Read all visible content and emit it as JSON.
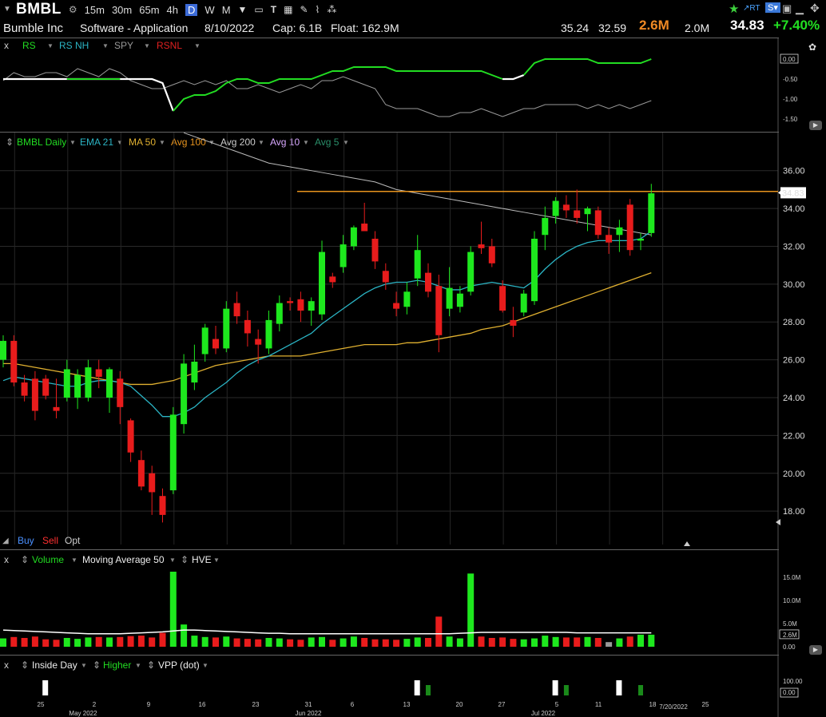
{
  "toolbar": {
    "symbol": "BMBL",
    "timeframes": [
      "15m",
      "30m",
      "65m",
      "4h",
      "D",
      "W",
      "M"
    ],
    "selected_timeframe": "D",
    "right_labels": {
      "rt": "RT",
      "s": "S"
    }
  },
  "info": {
    "name": "Bumble Inc",
    "sector": "Software - Application",
    "date": "8/10/2022",
    "cap": "Cap: 6.1B",
    "float": "Float: 162.9M",
    "high": "35.24",
    "low": "32.59",
    "volume": "2.6M",
    "avg_volume": "2.0M",
    "price": "34.83",
    "change": "+7.40%"
  },
  "rs_panel": {
    "legend": [
      "RS",
      "RS NH",
      "SPY",
      "RSNL"
    ],
    "close": "x",
    "axis": [
      "0.00",
      "-0.50",
      "-1.00",
      "-1.50"
    ]
  },
  "price_panel": {
    "legend": [
      "BMBL Daily",
      "EMA 21",
      "MA 50",
      "Avg 100",
      "Avg 200",
      "Avg 10",
      "Avg 5"
    ],
    "axis": [
      "36.00",
      "34.00",
      "32.00",
      "30.00",
      "28.00",
      "26.00",
      "24.00",
      "22.00",
      "20.00",
      "18.00"
    ],
    "last_price_tag": "34.83",
    "trade_buttons": [
      "Buy",
      "Sell",
      "Opt"
    ]
  },
  "volume_panel": {
    "legend": [
      "Volume",
      "Moving Average 50",
      "HVE"
    ],
    "close": "x",
    "axis": [
      "15.0M",
      "10.0M",
      "5.0M",
      "2.6M",
      "0.00"
    ]
  },
  "pattern_panel": {
    "legend": [
      "Inside Day",
      "Higher",
      "VPP (dot)"
    ],
    "close": "x",
    "axis": [
      "100.00",
      "0.00"
    ]
  },
  "x_axis": {
    "ticks": [
      "25",
      "May 2022",
      "2",
      "9",
      "16",
      "23",
      "Jun 2022",
      "31",
      "6",
      "13",
      "20",
      "27",
      "Jul 2022",
      "5",
      "11",
      "18",
      "25"
    ],
    "current_date_label": "7/20/2022"
  },
  "colors": {
    "up": "#1ee81e",
    "down": "#e81c1c",
    "ema21": "#2bb4c4",
    "ma50": "#e0b030",
    "avg200": "#bbbbbb",
    "resistance": "#e8941e",
    "rs": "#22dd22"
  },
  "chart_data": {
    "type": "candlestick",
    "ylim": [
      17.5,
      37
    ],
    "resistance_level": 34.9,
    "candles": [
      {
        "o": 26.0,
        "h": 27.3,
        "l": 25.6,
        "c": 27.0
      },
      {
        "o": 27.0,
        "h": 27.3,
        "l": 24.6,
        "c": 24.8
      },
      {
        "o": 24.8,
        "h": 25.2,
        "l": 23.8,
        "c": 24.1
      },
      {
        "o": 25.0,
        "h": 25.4,
        "l": 22.8,
        "c": 23.3
      },
      {
        "o": 25.0,
        "h": 25.2,
        "l": 23.9,
        "c": 24.1
      },
      {
        "o": 23.5,
        "h": 25.0,
        "l": 22.9,
        "c": 23.3
      },
      {
        "o": 24.0,
        "h": 26.0,
        "l": 23.8,
        "c": 25.5
      },
      {
        "o": 24.0,
        "h": 25.5,
        "l": 23.4,
        "c": 25.2
      },
      {
        "o": 24.0,
        "h": 26.0,
        "l": 23.8,
        "c": 25.6
      },
      {
        "o": 25.5,
        "h": 26.0,
        "l": 24.5,
        "c": 25.1
      },
      {
        "o": 24.0,
        "h": 25.6,
        "l": 23.2,
        "c": 25.5
      },
      {
        "o": 25.0,
        "h": 25.4,
        "l": 22.6,
        "c": 23.5
      },
      {
        "o": 22.8,
        "h": 22.9,
        "l": 20.6,
        "c": 21.1
      },
      {
        "o": 20.7,
        "h": 21.2,
        "l": 19.1,
        "c": 19.3
      },
      {
        "o": 20.0,
        "h": 20.4,
        "l": 17.8,
        "c": 19.0
      },
      {
        "o": 18.8,
        "h": 19.2,
        "l": 17.4,
        "c": 17.8
      },
      {
        "o": 19.1,
        "h": 23.5,
        "l": 18.9,
        "c": 23.1
      },
      {
        "o": 22.6,
        "h": 26.3,
        "l": 22.1,
        "c": 25.8
      },
      {
        "o": 24.8,
        "h": 26.8,
        "l": 24.4,
        "c": 25.9
      },
      {
        "o": 26.3,
        "h": 27.9,
        "l": 25.9,
        "c": 27.7
      },
      {
        "o": 27.1,
        "h": 27.8,
        "l": 26.3,
        "c": 26.6
      },
      {
        "o": 26.6,
        "h": 29.1,
        "l": 26.4,
        "c": 28.7
      },
      {
        "o": 29.0,
        "h": 29.6,
        "l": 27.9,
        "c": 28.3
      },
      {
        "o": 28.1,
        "h": 28.6,
        "l": 26.7,
        "c": 27.4
      },
      {
        "o": 27.1,
        "h": 27.6,
        "l": 25.8,
        "c": 26.8
      },
      {
        "o": 26.6,
        "h": 28.6,
        "l": 26.3,
        "c": 28.1
      },
      {
        "o": 27.9,
        "h": 29.4,
        "l": 27.5,
        "c": 29.0
      },
      {
        "o": 29.1,
        "h": 29.3,
        "l": 28.6,
        "c": 29.0
      },
      {
        "o": 29.2,
        "h": 29.6,
        "l": 28.0,
        "c": 28.6
      },
      {
        "o": 28.6,
        "h": 29.3,
        "l": 27.8,
        "c": 29.1
      },
      {
        "o": 28.4,
        "h": 32.3,
        "l": 28.1,
        "c": 31.7
      },
      {
        "o": 30.4,
        "h": 30.6,
        "l": 29.8,
        "c": 30.1
      },
      {
        "o": 30.9,
        "h": 32.6,
        "l": 30.6,
        "c": 32.1
      },
      {
        "o": 32.0,
        "h": 33.1,
        "l": 31.8,
        "c": 33.0
      },
      {
        "o": 33.2,
        "h": 34.3,
        "l": 32.8,
        "c": 32.8
      },
      {
        "o": 32.4,
        "h": 32.8,
        "l": 30.8,
        "c": 31.2
      },
      {
        "o": 30.7,
        "h": 31.1,
        "l": 29.7,
        "c": 30.1
      },
      {
        "o": 29.0,
        "h": 29.6,
        "l": 28.3,
        "c": 28.7
      },
      {
        "o": 28.8,
        "h": 30.1,
        "l": 28.4,
        "c": 29.6
      },
      {
        "o": 30.3,
        "h": 32.6,
        "l": 29.9,
        "c": 31.8
      },
      {
        "o": 30.6,
        "h": 31.1,
        "l": 29.3,
        "c": 29.6
      },
      {
        "o": 29.9,
        "h": 30.5,
        "l": 26.4,
        "c": 27.3
      },
      {
        "o": 28.7,
        "h": 30.9,
        "l": 28.3,
        "c": 29.8
      },
      {
        "o": 28.8,
        "h": 29.9,
        "l": 28.5,
        "c": 29.5
      },
      {
        "o": 29.6,
        "h": 32.0,
        "l": 29.4,
        "c": 31.7
      },
      {
        "o": 32.1,
        "h": 33.3,
        "l": 31.6,
        "c": 31.9
      },
      {
        "o": 32.0,
        "h": 32.4,
        "l": 30.9,
        "c": 31.1
      },
      {
        "o": 29.9,
        "h": 30.2,
        "l": 28.5,
        "c": 28.6
      },
      {
        "o": 28.1,
        "h": 28.8,
        "l": 27.2,
        "c": 27.8
      },
      {
        "o": 28.5,
        "h": 29.7,
        "l": 28.3,
        "c": 29.5
      },
      {
        "o": 29.1,
        "h": 32.8,
        "l": 28.9,
        "c": 32.4
      },
      {
        "o": 32.6,
        "h": 34.1,
        "l": 31.8,
        "c": 33.5
      },
      {
        "o": 33.6,
        "h": 34.6,
        "l": 33.2,
        "c": 34.4
      },
      {
        "o": 34.2,
        "h": 34.7,
        "l": 33.5,
        "c": 33.9
      },
      {
        "o": 33.9,
        "h": 35.0,
        "l": 33.2,
        "c": 33.5
      },
      {
        "o": 33.7,
        "h": 34.1,
        "l": 32.8,
        "c": 34.0
      },
      {
        "o": 33.9,
        "h": 34.1,
        "l": 32.4,
        "c": 32.6
      },
      {
        "o": 32.6,
        "h": 33.0,
        "l": 31.6,
        "c": 32.2
      },
      {
        "o": 32.6,
        "h": 33.4,
        "l": 31.7,
        "c": 33.0
      },
      {
        "o": 34.2,
        "h": 34.5,
        "l": 31.5,
        "c": 31.8
      },
      {
        "o": 32.3,
        "h": 32.7,
        "l": 31.8,
        "c": 32.4
      },
      {
        "o": 32.7,
        "h": 35.3,
        "l": 32.5,
        "c": 34.8
      }
    ],
    "ema21": [
      24.9,
      25.1,
      25.0,
      24.9,
      24.8,
      24.7,
      24.6,
      24.6,
      24.8,
      24.9,
      24.9,
      24.8,
      24.6,
      24.1,
      23.6,
      23.0,
      23.0,
      23.2,
      23.5,
      24.0,
      24.4,
      24.8,
      25.3,
      25.7,
      26.0,
      26.2,
      26.5,
      26.8,
      27.1,
      27.4,
      27.9,
      28.3,
      28.7,
      29.1,
      29.5,
      29.8,
      30.0,
      30.1,
      30.1,
      30.2,
      30.1,
      29.9,
      29.7,
      29.7,
      29.9,
      30.0,
      30.1,
      30.0,
      29.9,
      29.8,
      30.2,
      30.8,
      31.3,
      31.7,
      32.0,
      32.2,
      32.3,
      32.3,
      32.3,
      32.3,
      32.4,
      32.8
    ],
    "ma50": [
      25.8,
      25.8,
      25.7,
      25.6,
      25.5,
      25.4,
      25.3,
      25.2,
      25.1,
      25.0,
      24.9,
      24.8,
      24.7,
      24.7,
      24.7,
      24.8,
      24.9,
      25.1,
      25.3,
      25.5,
      25.7,
      25.8,
      25.9,
      26.0,
      26.1,
      26.2,
      26.2,
      26.2,
      26.2,
      26.3,
      26.4,
      26.5,
      26.6,
      26.7,
      26.8,
      26.8,
      26.8,
      26.8,
      26.9,
      26.9,
      27.0,
      27.1,
      27.2,
      27.3,
      27.4,
      27.6,
      27.7,
      27.8,
      28.0,
      28.2,
      28.4,
      28.6,
      28.8,
      29.0,
      29.2,
      29.4,
      29.6,
      29.8,
      30.0,
      30.2,
      30.4,
      30.6
    ],
    "avg200_x": [
      17,
      18,
      19,
      20,
      21,
      22,
      23,
      24,
      25,
      26,
      27,
      28,
      29,
      30,
      31,
      32,
      33,
      34,
      35,
      36,
      37,
      38,
      39,
      40,
      41,
      42,
      43,
      44,
      45,
      46,
      47,
      48,
      49,
      50,
      51,
      52,
      53,
      54,
      55,
      56,
      57,
      58,
      59,
      60,
      61
    ],
    "avg200": [
      38.0,
      37.8,
      37.6,
      37.4,
      37.2,
      37.0,
      36.8,
      36.6,
      36.4,
      36.3,
      36.2,
      36.1,
      36.0,
      35.9,
      35.8,
      35.7,
      35.6,
      35.5,
      35.4,
      35.2,
      35.0,
      34.9,
      34.8,
      34.7,
      34.6,
      34.5,
      34.4,
      34.3,
      34.2,
      34.1,
      34.0,
      33.9,
      33.8,
      33.7,
      33.6,
      33.5,
      33.4,
      33.3,
      33.2,
      33.1,
      33.0,
      32.9,
      32.8,
      32.7,
      32.6
    ],
    "volume_m": [
      1.8,
      2.1,
      1.9,
      2.2,
      1.6,
      1.5,
      1.9,
      1.7,
      2.0,
      2.1,
      2.0,
      2.1,
      2.3,
      2.4,
      2.0,
      3.0,
      16.2,
      4.8,
      2.4,
      2.1,
      2.0,
      2.2,
      1.8,
      1.7,
      1.6,
      1.9,
      1.8,
      1.6,
      1.5,
      2.0,
      2.1,
      1.5,
      1.8,
      2.2,
      1.9,
      1.6,
      1.6,
      1.5,
      1.7,
      2.0,
      1.9,
      6.5,
      2.2,
      1.8,
      15.8,
      2.2,
      1.9,
      2.0,
      1.7,
      1.6,
      1.8,
      2.4,
      2.1,
      2.0,
      2.0,
      2.1,
      1.9,
      1.0,
      1.8,
      2.2,
      2.6,
      2.6
    ],
    "volume_ma50": [
      3.6,
      3.5,
      3.4,
      3.3,
      3.2,
      3.1,
      3.0,
      2.9,
      2.8,
      2.8,
      2.8,
      2.8,
      2.9,
      3.0,
      3.1,
      3.2,
      3.4,
      3.6,
      3.6,
      3.5,
      3.4,
      3.3,
      3.2,
      3.1,
      3.0,
      2.9,
      2.9,
      2.8,
      2.8,
      2.8,
      2.8,
      2.8,
      2.8,
      2.8,
      2.8,
      2.8,
      2.8,
      2.8,
      2.8,
      2.8,
      2.8,
      2.8,
      2.8,
      2.9,
      3.0,
      3.1,
      3.1,
      3.1,
      3.1,
      3.1,
      3.1,
      3.1,
      3.1,
      3.1,
      3.0,
      3.0,
      3.0,
      3.0,
      3.0,
      3.0,
      3.0,
      3.0
    ],
    "rs_line": [
      -0.5,
      -0.5,
      -0.5,
      -0.5,
      -0.5,
      -0.5,
      -0.5,
      -0.5,
      -0.5,
      -0.5,
      -0.5,
      -0.5,
      -0.5,
      -0.5,
      -0.5,
      -0.6,
      -1.3,
      -1.0,
      -0.9,
      -0.9,
      -0.8,
      -0.6,
      -0.5,
      -0.5,
      -0.6,
      -0.6,
      -0.5,
      -0.5,
      -0.5,
      -0.5,
      -0.4,
      -0.3,
      -0.3,
      -0.2,
      -0.2,
      -0.2,
      -0.2,
      -0.3,
      -0.3,
      -0.3,
      -0.3,
      -0.3,
      -0.3,
      -0.3,
      -0.3,
      -0.3,
      -0.4,
      -0.5,
      -0.5,
      -0.4,
      -0.1,
      0.0,
      0.0,
      0.0,
      0.0,
      0.0,
      -0.1,
      -0.1,
      -0.1,
      -0.1,
      -0.1,
      0.0
    ],
    "spy_line": [
      -0.5,
      -0.3,
      -0.4,
      -0.4,
      -0.3,
      -0.3,
      -0.4,
      -0.2,
      -0.3,
      -0.4,
      -0.2,
      -0.3,
      -0.5,
      -0.6,
      -0.7,
      -0.7,
      -0.6,
      -0.5,
      -0.6,
      -0.5,
      -0.6,
      -0.5,
      -0.7,
      -0.7,
      -0.6,
      -0.7,
      -0.8,
      -0.7,
      -0.6,
      -0.7,
      -0.5,
      -0.5,
      -0.4,
      -0.5,
      -0.6,
      -0.7,
      -1.1,
      -1.2,
      -1.2,
      -1.2,
      -1.3,
      -1.4,
      -1.4,
      -1.3,
      -1.3,
      -1.2,
      -1.3,
      -1.4,
      -1.3,
      -1.2,
      -1.2,
      -1.1,
      -1.1,
      -1.1,
      -1.1,
      -1.2,
      -1.1,
      -1.2,
      -1.1,
      -1.2,
      -1.1,
      -1.0
    ],
    "inside_day": [
      0,
      0,
      0,
      0,
      1,
      0,
      0,
      0,
      0,
      0,
      0,
      0,
      0,
      0,
      0,
      0,
      0,
      0,
      0,
      0,
      0,
      0,
      0,
      0,
      0,
      0,
      0,
      0,
      0,
      0,
      0,
      0,
      0,
      0,
      0,
      0,
      0,
      0,
      0,
      1,
      0,
      0,
      0,
      0,
      0,
      0,
      0,
      0,
      0,
      0,
      0,
      0,
      1,
      0,
      0,
      0,
      0,
      0,
      1,
      0,
      0,
      0
    ],
    "higher": [
      0,
      0,
      0,
      0,
      0,
      0,
      0,
      0,
      0,
      0,
      0,
      0,
      0,
      0,
      0,
      0,
      0,
      0,
      0,
      0,
      0,
      0,
      0,
      0,
      0,
      0,
      0,
      0,
      0,
      0,
      0,
      0,
      0,
      0,
      0,
      0,
      0,
      0,
      0,
      0,
      1,
      0,
      0,
      0,
      0,
      0,
      0,
      0,
      0,
      0,
      0,
      0,
      0,
      1,
      0,
      0,
      0,
      0,
      0,
      0,
      1,
      0
    ]
  }
}
